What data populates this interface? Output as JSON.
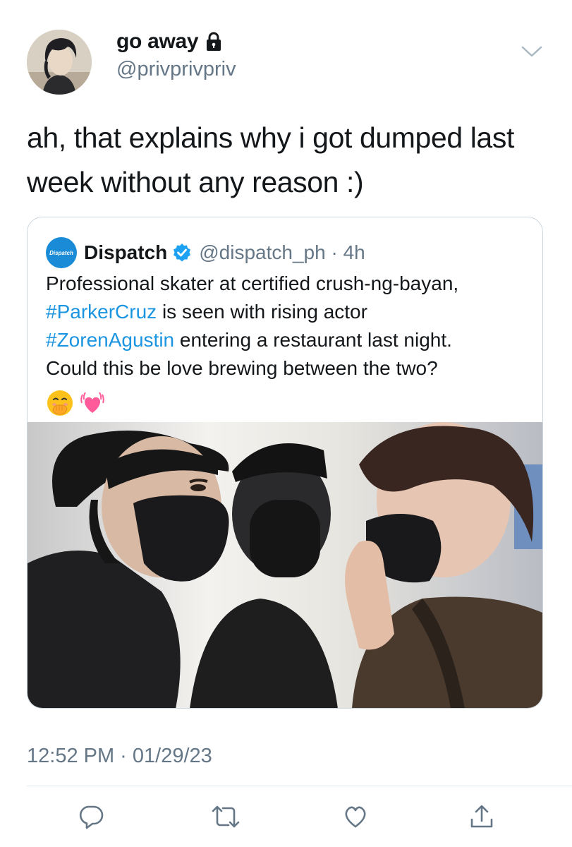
{
  "author": {
    "display_name": "go away",
    "handle": "@privprivpriv",
    "avatar_icon": "user-avatar",
    "protected_icon": "lock-icon"
  },
  "tweet": {
    "text": "ah, that explains why i got dumped last week without any reason :)",
    "timestamp": "12:52 PM · 01/29/23"
  },
  "quote": {
    "avatar_text": "Dispatch",
    "name": "Dispatch",
    "verified_icon": "verified-badge-icon",
    "handle_time": "@dispatch_ph · 4h",
    "text_parts": {
      "line1": "Professional skater at certified crush-ng-bayan,",
      "hashtag1": "#ParkerCruz",
      "after1": " is seen with rising actor",
      "hashtag2": "#ZorenAgustin",
      "after2": " entering a restaurant last night.",
      "line4": "Could this be love brewing between the two?"
    },
    "emojis": [
      "face-with-hand-over-mouth-emoji",
      "beating-heart-emoji"
    ],
    "photo": "photo of two people in black face masks"
  },
  "actions": [
    "reply-icon",
    "retweet-icon",
    "like-icon",
    "share-icon"
  ],
  "colors": {
    "link": "#1b95e0",
    "secondary_text": "#657786",
    "verified": "#1da1f2",
    "border": "#ccd6dd"
  }
}
